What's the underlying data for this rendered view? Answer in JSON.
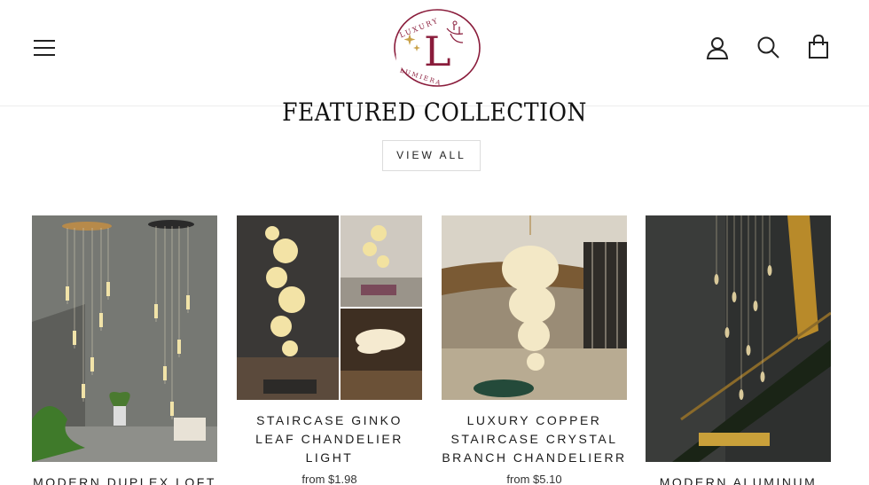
{
  "header": {
    "menu_icon": "hamburger-menu-icon",
    "account_icon": "user-account-icon",
    "search_icon": "search-icon",
    "cart_icon": "shopping-bag-icon",
    "logo": {
      "monogram": "L",
      "top_text": "LUXURY",
      "bottom_text": "LUMIERA",
      "color": "#8a1c3b"
    }
  },
  "collection": {
    "title": "FEATURED COLLECTION",
    "view_all_label": "VIEW ALL"
  },
  "products": [
    {
      "title": "MODERN DUPLEX LOFT",
      "price": ""
    },
    {
      "title": "STAIRCASE GINKO LEAF CHANDELIER LIGHT",
      "price": "from $1.98"
    },
    {
      "title": "LUXURY COPPER STAIRCASE CRYSTAL BRANCH CHANDELIERR",
      "price": "from $5.10"
    },
    {
      "title": "MODERN ALUMINUM",
      "price": ""
    }
  ]
}
